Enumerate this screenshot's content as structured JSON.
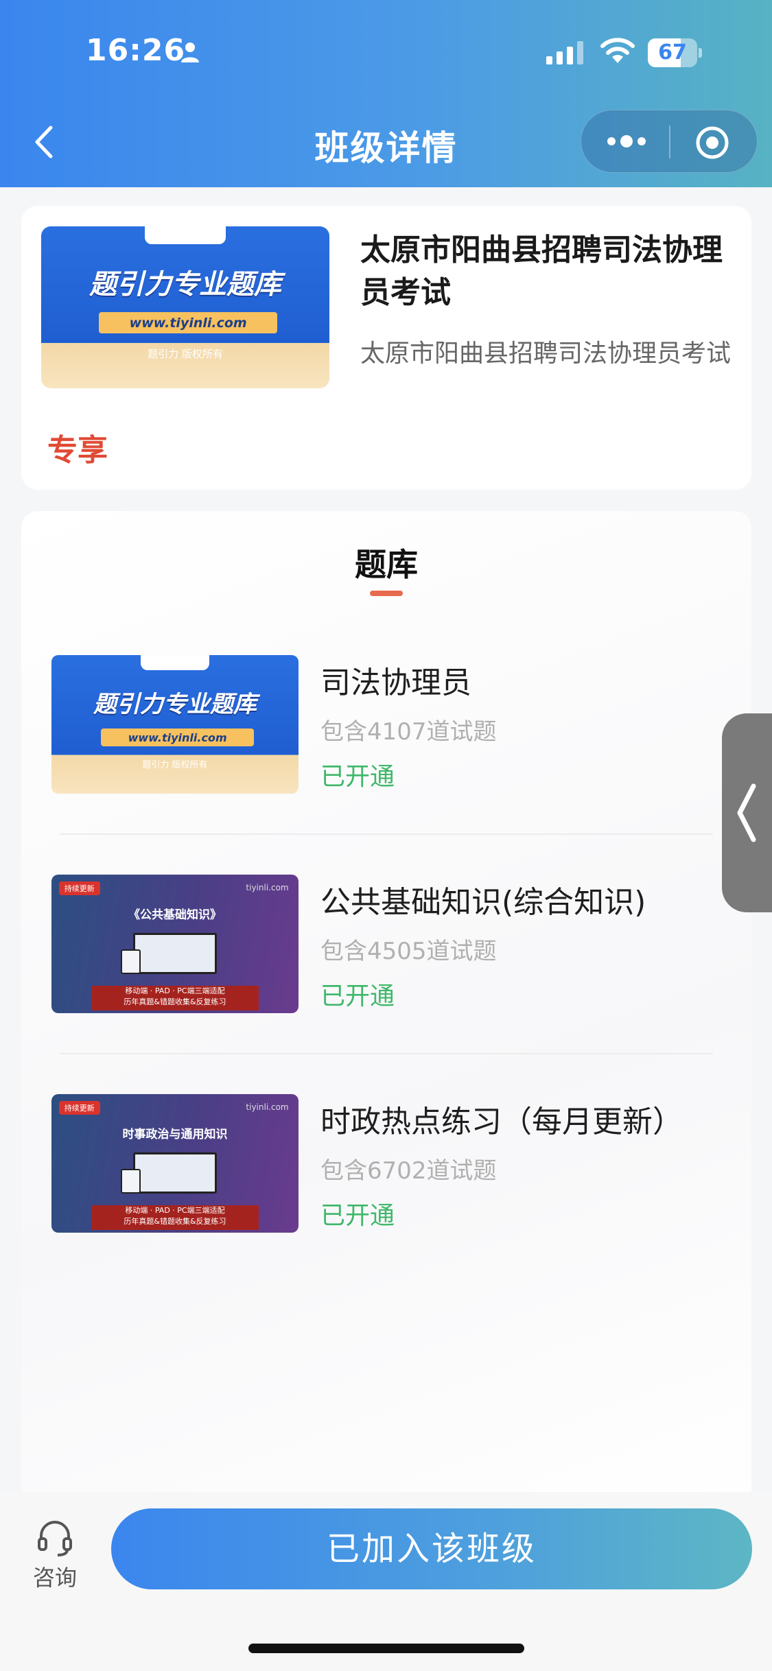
{
  "status_bar": {
    "time": "16:26",
    "battery": "67",
    "battery_level": 0.67
  },
  "nav": {
    "title": "班级详情"
  },
  "class_card": {
    "cover": {
      "brand": "题引力专业题库",
      "url": "www.tiyinli.com",
      "copyright": "题引力 版权所有"
    },
    "title": "太原市阳曲县招聘司法协理员考试",
    "subtitle": "太原市阳曲县招聘司法协理员考试",
    "tag": "专享"
  },
  "bank_section": {
    "tab_label": "题库",
    "items": [
      {
        "name": "司法协理员",
        "count": "包含4107道试题",
        "status": "已开通",
        "cover": {
          "style": "blue",
          "brand": "题引力专业题库",
          "url": "www.tiyinli.com",
          "copyright": "题引力 版权所有"
        }
      },
      {
        "name": "公共基础知识(综合知识)",
        "count": "包含4505道试题",
        "status": "已开通",
        "cover": {
          "style": "purple",
          "badge": "持续更新",
          "site": "tiyinli.com",
          "headline": "《公共基础知识》",
          "band_line1": "移动端 · PAD · PC端三端适配",
          "band_line2": "历年真题&错题收集&反复练习"
        }
      },
      {
        "name": "时政热点练习（每月更新）",
        "count": "包含6702道试题",
        "status": "已开通",
        "cover": {
          "style": "purple",
          "badge": "持续更新",
          "site": "tiyinli.com",
          "headline": "时事政治与通用知识",
          "band_line1": "移动端 · PAD · PC端三端适配",
          "band_line2": "历年真题&错题收集&反复练习"
        }
      }
    ]
  },
  "bottom_bar": {
    "consult_label": "咨询",
    "join_button": "已加入该班级"
  },
  "colors": {
    "accent_blue": "#3a86ee",
    "accent_teal": "#5db6c4",
    "status_green": "#3fb86a",
    "tag_red": "#e04a34",
    "underline_orange": "#e86a4e"
  }
}
